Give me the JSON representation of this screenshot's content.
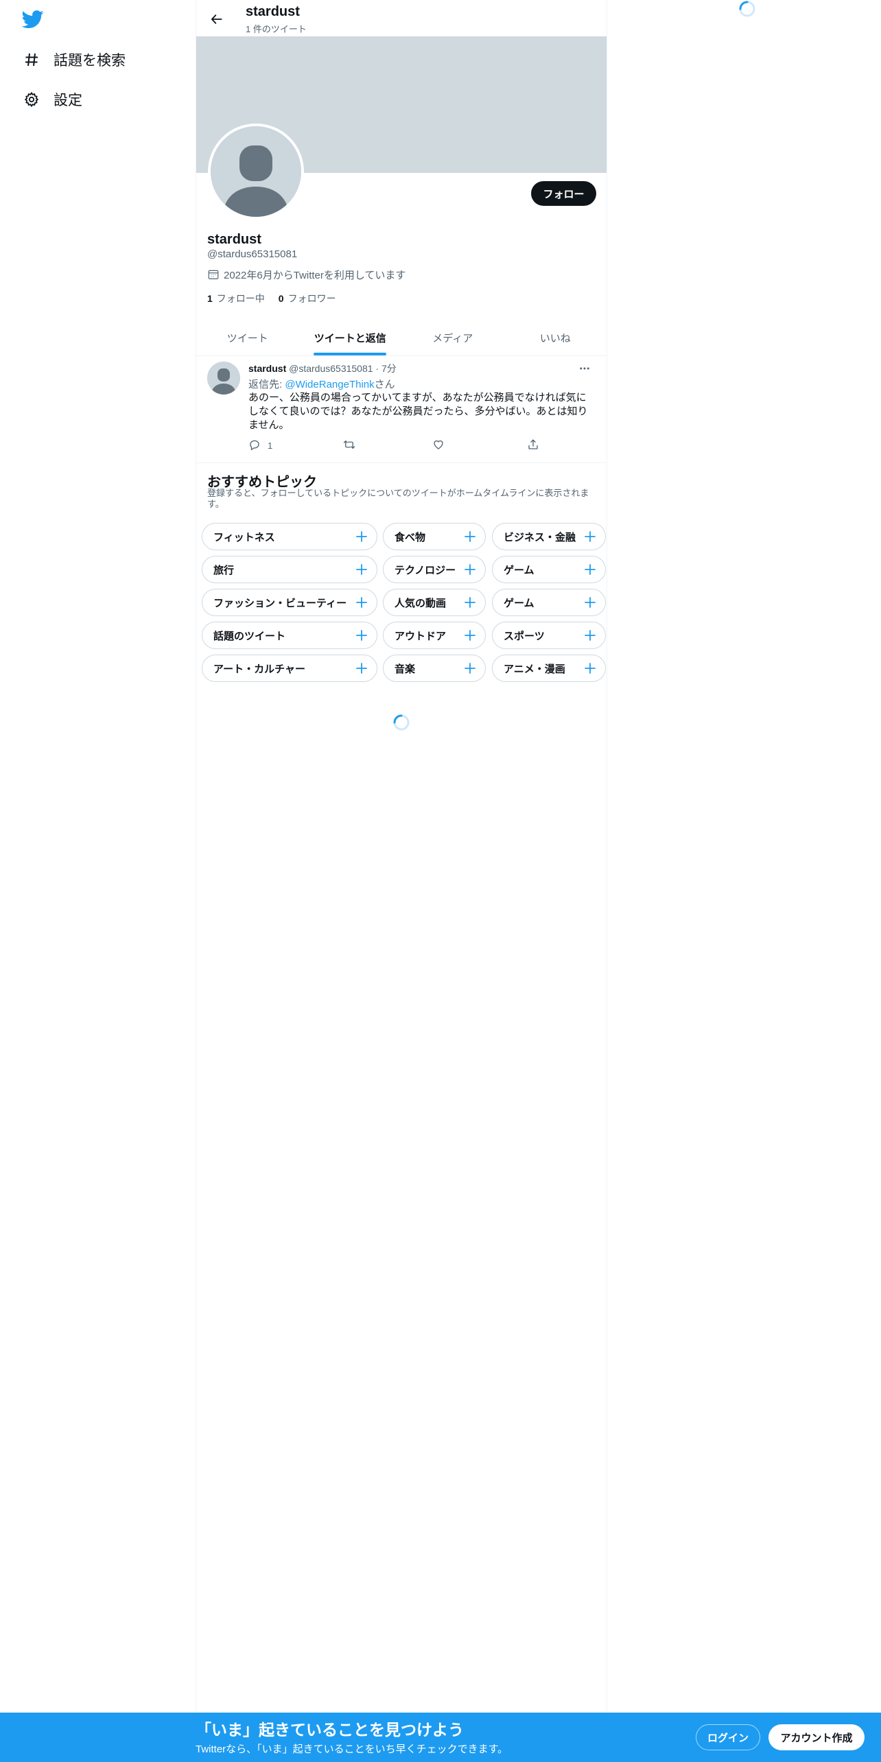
{
  "colors": {
    "accent": "#1d9bf0",
    "text": "#0f1419",
    "muted": "#536471",
    "banner": "#cfd9de"
  },
  "nav": {
    "logo_icon": "twitter-bird-icon",
    "items": [
      {
        "icon": "hashtag-icon",
        "label": "話題を検索"
      },
      {
        "icon": "gear-icon",
        "label": "設定"
      }
    ]
  },
  "topbar": {
    "title": "stardust",
    "subtitle": "1 件のツイート"
  },
  "profile": {
    "name": "stardust",
    "handle": "@stardus65315081",
    "joined": "2022年6月からTwitterを利用しています",
    "following_count": "1",
    "following_label": "フォロー中",
    "followers_count": "0",
    "followers_label": "フォロワー",
    "follow_button": "フォロー"
  },
  "tabs": [
    {
      "label": "ツイート",
      "active": false
    },
    {
      "label": "ツイートと返信",
      "active": true
    },
    {
      "label": "メディア",
      "active": false
    },
    {
      "label": "いいね",
      "active": false
    }
  ],
  "tweet": {
    "name": "stardust",
    "handle_time": "@stardus65315081 · 7分",
    "reply_prefix": "返信先: ",
    "reply_mention": "@WideRangeThink",
    "reply_suffix": "さん",
    "text": "あのー、公務員の場合ってかいてますが、あなたが公務員でなければ気にしなくて良いのでは？あなたが公務員だったら、多分やばい。あとは知りません。",
    "reply_count": "1"
  },
  "topics": {
    "title": "おすすめトピック",
    "description": "登録すると、フォローしているトピックについてのツイートがホームタイムラインに表示されます。",
    "items": [
      "フィットネス",
      "食べ物",
      "ビジネス・金融",
      "旅行",
      "テクノロジー",
      "ゲーム",
      "ファッション・ビューティー",
      "人気の動画",
      "ゲーム",
      "話題のツイート",
      "アウトドア",
      "スポーツ",
      "アート・カルチャー",
      "音楽",
      "アニメ・漫画"
    ]
  },
  "bottombar": {
    "title": "「いま」起きていることを見つけよう",
    "subtitle": "Twitterなら、「いま」起きていることをいち早くチェックできます。",
    "login": "ログイン",
    "signup": "アカウント作成"
  }
}
